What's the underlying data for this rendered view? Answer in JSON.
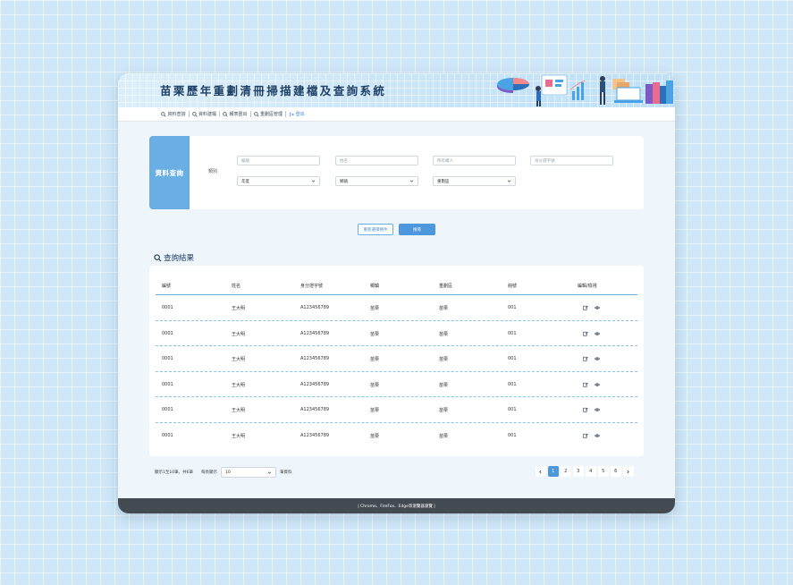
{
  "app_title": "苗栗歷年重劃清冊掃描建檔及查詢系統",
  "nav": [
    {
      "icon": "search-icon",
      "label": "資料查詢"
    },
    {
      "icon": "search-icon",
      "label": "資料建檔"
    },
    {
      "icon": "search-icon",
      "label": "報表匯出"
    },
    {
      "icon": "search-icon",
      "label": "重劃區管理"
    },
    {
      "icon": "logout-icon",
      "label": "登出"
    }
  ],
  "search": {
    "side_title": "資料查詢",
    "category_label": "類別",
    "fields": [
      {
        "placeholder": "編號"
      },
      {
        "placeholder": "姓名"
      },
      {
        "placeholder": "所有權人"
      },
      {
        "placeholder": "身分證字號"
      }
    ],
    "selects": [
      {
        "value": "年度"
      },
      {
        "value": "鄉鎮"
      },
      {
        "value": "重劃區"
      }
    ],
    "reset_label": "重新選擇條件",
    "search_label": "搜尋"
  },
  "results": {
    "title": "查詢結果",
    "columns": [
      "編號",
      "姓名",
      "身分證字號",
      "鄉鎮",
      "重劃區",
      "冊號",
      "編輯/檢視"
    ],
    "rows": [
      {
        "id": "0001",
        "name": "王大明",
        "idno": "A123456789",
        "town": "苗栗",
        "zone": "苗栗",
        "book": "001"
      },
      {
        "id": "0001",
        "name": "王大明",
        "idno": "A123456789",
        "town": "苗栗",
        "zone": "苗栗",
        "book": "001"
      },
      {
        "id": "0001",
        "name": "王大明",
        "idno": "A123456789",
        "town": "苗栗",
        "zone": "苗栗",
        "book": "001"
      },
      {
        "id": "0001",
        "name": "王大明",
        "idno": "A123456789",
        "town": "苗栗",
        "zone": "苗栗",
        "book": "001"
      },
      {
        "id": "0001",
        "name": "王大明",
        "idno": "A123456789",
        "town": "苗栗",
        "zone": "苗栗",
        "book": "001"
      },
      {
        "id": "0001",
        "name": "王大明",
        "idno": "A123456789",
        "town": "苗栗",
        "zone": "苗栗",
        "book": "001"
      }
    ]
  },
  "pagination": {
    "summary": "顯示1至10筆，共6筆",
    "per_page_label": "每頁顯示",
    "per_page_value": "10",
    "unit_label": "筆資料",
    "pages": [
      "1",
      "2",
      "3",
      "4",
      "5",
      "6"
    ],
    "current": "1"
  },
  "footer_text": "| Chrome、FireFox、Edge等瀏覽器瀏覽 |",
  "colors": {
    "accent": "#4d98dd",
    "side_panel": "#6aafe3",
    "footer": "#444a52",
    "title": "#1e3f66"
  }
}
